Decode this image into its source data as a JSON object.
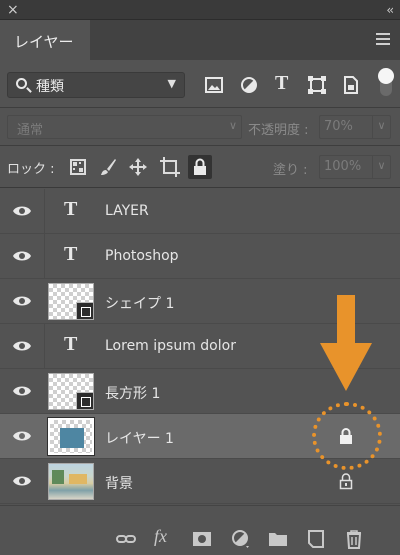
{
  "window": {
    "close_glyph": "×",
    "collapse_glyph": "‹‹"
  },
  "panel": {
    "tab_label": "レイヤー",
    "menu_icon": "hamburger-icon"
  },
  "filter": {
    "kind_label": "種類",
    "filter_icons": [
      "image-filter-icon",
      "adjustment-filter-icon",
      "text-filter-icon",
      "shape-filter-icon",
      "smart-object-filter-icon"
    ],
    "toggle_state": "on"
  },
  "blend": {
    "mode": "通常",
    "opacity_label": "不透明度 :",
    "opacity_value": "70%"
  },
  "lock": {
    "label": "ロック :",
    "icons": [
      "lock-transparent-pixels-icon",
      "lock-image-pixels-icon",
      "lock-position-icon",
      "lock-artboard-icon",
      "lock-all-icon"
    ],
    "fill_label": "塗り :",
    "fill_value": "100%"
  },
  "layers": [
    {
      "name": "LAYER",
      "kind": "text",
      "visible": true
    },
    {
      "name": "Photoshop",
      "kind": "text",
      "visible": true
    },
    {
      "name": "シェイプ 1",
      "kind": "shape",
      "visible": true
    },
    {
      "name": "Lorem ipsum dolor",
      "kind": "text",
      "visible": true
    },
    {
      "name": "長方形 1",
      "kind": "shape",
      "visible": true
    },
    {
      "name": "レイヤー 1",
      "kind": "pixel",
      "visible": true,
      "selected": true,
      "locked": true
    },
    {
      "name": "背景",
      "kind": "background",
      "visible": true,
      "locked": true
    }
  ],
  "text_glyph": "T",
  "footer_icons": [
    "link-layers-icon",
    "fx-icon",
    "add-mask-icon",
    "new-fill-adjustment-icon",
    "new-group-icon",
    "new-layer-icon",
    "delete-icon"
  ],
  "fx_label": "fx",
  "colors": {
    "annotation": "#e8932b",
    "selected_row": "#6a6a6a",
    "panel_bg": "#535353"
  }
}
